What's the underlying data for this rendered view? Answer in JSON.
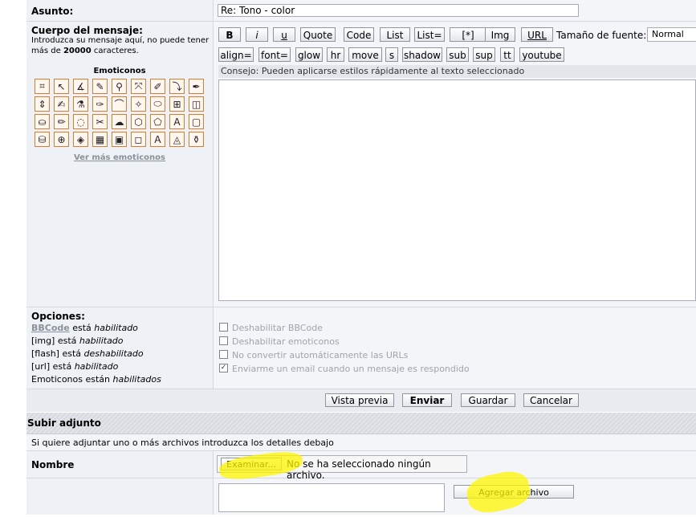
{
  "subject": {
    "label": "Asunto:",
    "value": "Re: Tono - color"
  },
  "body": {
    "label": "Cuerpo del mensaje:",
    "hint_prefix": "Introduzca su mensaje aquí, no puede tener más de ",
    "hint_limit": "20000",
    "hint_suffix": " caracteres.",
    "emoticons_title": "Emoticonos",
    "more_emoticons": "Ver más emoticonos",
    "emoticon_icons": [
      "crop-icon",
      "pointer-icon",
      "compass-icon",
      "pen-icon",
      "magnifier-icon",
      "node-icon",
      "eraser-icon",
      "path-icon",
      "nib-icon",
      "resize-icon",
      "brush-icon",
      "dropper-icon",
      "pen-tool-icon",
      "lasso-icon",
      "wand-icon",
      "ellipse-icon",
      "transform-icon",
      "cube-icon",
      "paint-bucket-icon",
      "marker-icon",
      "blend-icon",
      "knife-icon",
      "smudge-icon",
      "sponge-icon",
      "shape-icon",
      "type-icon",
      "rectangle-icon",
      "bucket-icon",
      "stamp-icon",
      "fill-icon",
      "grid-icon",
      "frame-icon",
      "square-icon",
      "text-icon",
      "gradient-icon",
      "funnel-icon"
    ],
    "tip": "Consejo: Pueden aplicarse estilos rápidamente al texto seleccionado",
    "font_size_label": "Tamaño de fuente:",
    "font_size_value": "Normal"
  },
  "toolbar": {
    "row1": [
      "B",
      "i",
      "u",
      "Quote",
      "Code",
      "List",
      "List=",
      "[*]",
      "Img",
      "URL"
    ],
    "row2": [
      "align=",
      "font=",
      "glow",
      "hr",
      "move",
      "s",
      "shadow",
      "sub",
      "sup",
      "tt",
      "youtube"
    ]
  },
  "options": {
    "title": "Opciones:",
    "bbcode_link": "BBCode",
    "bbcode_text": " está ",
    "bbcode_state": "habilitado",
    "img_text": "[img] está ",
    "img_state": "habilitado",
    "flash_text": "[flash] está ",
    "flash_state": "deshabilitado",
    "url_text": "[url] está ",
    "url_state": "habilitado",
    "emo_text": "Emoticonos están ",
    "emo_state": "habilitados",
    "checkboxes": [
      {
        "label": "Deshabilitar BBCode",
        "checked": false
      },
      {
        "label": "Deshabilitar emoticonos",
        "checked": false
      },
      {
        "label": "No convertir automáticamente las URLs",
        "checked": false
      },
      {
        "label": "Enviarme un email cuando un mensaje es respondido",
        "checked": true
      }
    ]
  },
  "actions": {
    "preview": "Vista previa",
    "submit": "Enviar",
    "save": "Guardar",
    "cancel": "Cancelar"
  },
  "attachment": {
    "section_title": "Subir adjunto",
    "instructions": "Si quiere adjuntar uno o más archivos introduzca los detalles debajo",
    "name_label": "Nombre",
    "browse": "Examinar...",
    "no_file": "No se ha seleccionado ningún archivo.",
    "add_file": "Agregar archivo"
  }
}
